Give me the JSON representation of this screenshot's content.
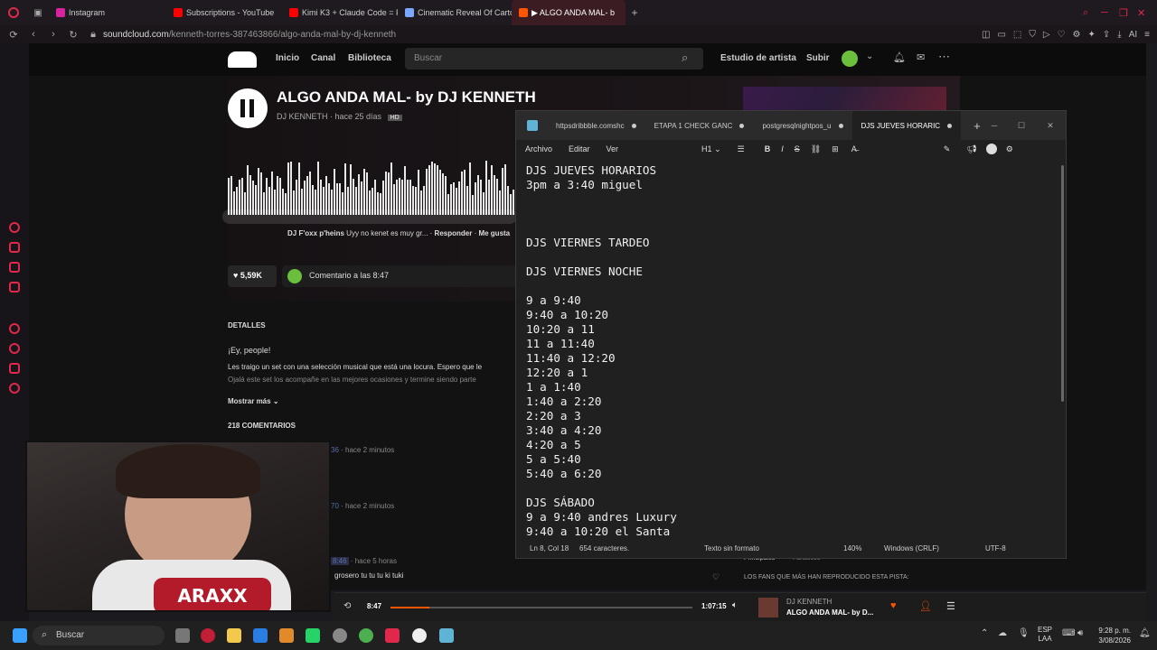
{
  "browser": {
    "tabs": [
      {
        "label": "Instagram",
        "color": "#d6249f"
      },
      {
        "label": "Subscriptions - YouTube",
        "color": "#ff0000"
      },
      {
        "label": "Kimi K3 + Claude Code = F",
        "color": "#ff0000"
      },
      {
        "label": "Cinematic Reveal Of Carto",
        "color": "#7aa7ff"
      },
      {
        "label": "▶ ALGO ANDA MAL- b",
        "color": "#ff5500",
        "active": true
      }
    ],
    "url_domain": "soundcloud.com",
    "url_path": "/kenneth-torres-387463866/algo-anda-mal-by-dj-kenneth",
    "ai_label": "AI"
  },
  "soundcloud": {
    "nav": {
      "inicio": "Inicio",
      "canal": "Canal",
      "biblioteca": "Biblioteca",
      "estudio": "Estudio de artista",
      "subir": "Subir"
    },
    "search_placeholder": "Buscar",
    "track_title": "ALGO ANDA MAL- by DJ KENNETH",
    "artist": "DJ KENNETH",
    "posted": "hace 25 días",
    "hd_badge": "HD",
    "comment_user": "DJ F'oxx p'heins",
    "comment_text": "Uyy no kenet es muy gr...",
    "comment_reply": "Responder",
    "comment_like": "Me gusta",
    "likes": "5,59K",
    "comment_at": "Comentario a las 8:47",
    "details_header": "DETALLES",
    "desc_1": "¡Ey, people!",
    "desc_2": "Les traigo un set con una selección musical que está una locura. Espero que le",
    "desc_3": "Ojalá este set los acompañe en las mejores ocasiones y termine siendo parte",
    "show_more": "Mostrar más",
    "comments_count": "218 COMENTARIOS",
    "comment_times": [
      "hace 2 minutos",
      "hace 2 minutos",
      "hace 5 horas"
    ],
    "comment_ts_a": "36",
    "comment_ts_b": "70",
    "comment_ts_c": "8:46",
    "comment_last": "grosero tu tu tu ki tuki",
    "fans_label": "LOS FANS QUE MÁS HAN REPRODUCIDO ESTA PISTA:",
    "tab_principales": "Principales",
    "tab_fanaticos": "Fanáticos"
  },
  "notepad": {
    "tabs": [
      "httpsdribbble.comshc",
      "ETAPA 1 CHECK GANC",
      "postgresqlnightpos_u",
      "DJS JUEVES HORARIC"
    ],
    "menu": {
      "archivo": "Archivo",
      "editar": "Editar",
      "ver": "Ver",
      "heading": "H1"
    },
    "lines": "DJS JUEVES HORARIOS\n3pm a 3:40 miguel\n\n\n\nDJS VIERNES TARDEO\n\nDJS VIERNES NOCHE\n\n9 a 9:40\n9:40 a 10:20\n10:20 a 11\n11 a 11:40\n11:40 a 12:20\n12:20 a 1\n1 a 1:40\n1:40 a 2:20\n2:20 a 3\n3:40 a 4:20\n4:20 a 5\n5 a 5:40\n5:40 a 6:20\n\nDJS SÁBADO\n9 a 9:40 andres Luxury\n9:40 a 10:20 el Santa",
    "status": {
      "pos": "Ln 8, Col 18",
      "chars": "654 caracteres.",
      "format": "Texto sin formato",
      "zoom": "140%",
      "eol": "Windows (CRLF)",
      "enc": "UTF-8"
    }
  },
  "player": {
    "elapsed": "8:47",
    "total": "1:07:15",
    "progress": 0.13,
    "artist": "DJ KENNETH",
    "title": "ALGO ANDA MAL- by D..."
  },
  "webcam": {
    "logo_text": "ARAXX"
  },
  "taskbar": {
    "search": "Buscar",
    "lang": "ESP",
    "lang2": "LAA",
    "time": "9:28 p. m.",
    "date": "3/08/2026"
  },
  "colors": {
    "accent": "#ff5500",
    "opera": "#e0294a"
  }
}
